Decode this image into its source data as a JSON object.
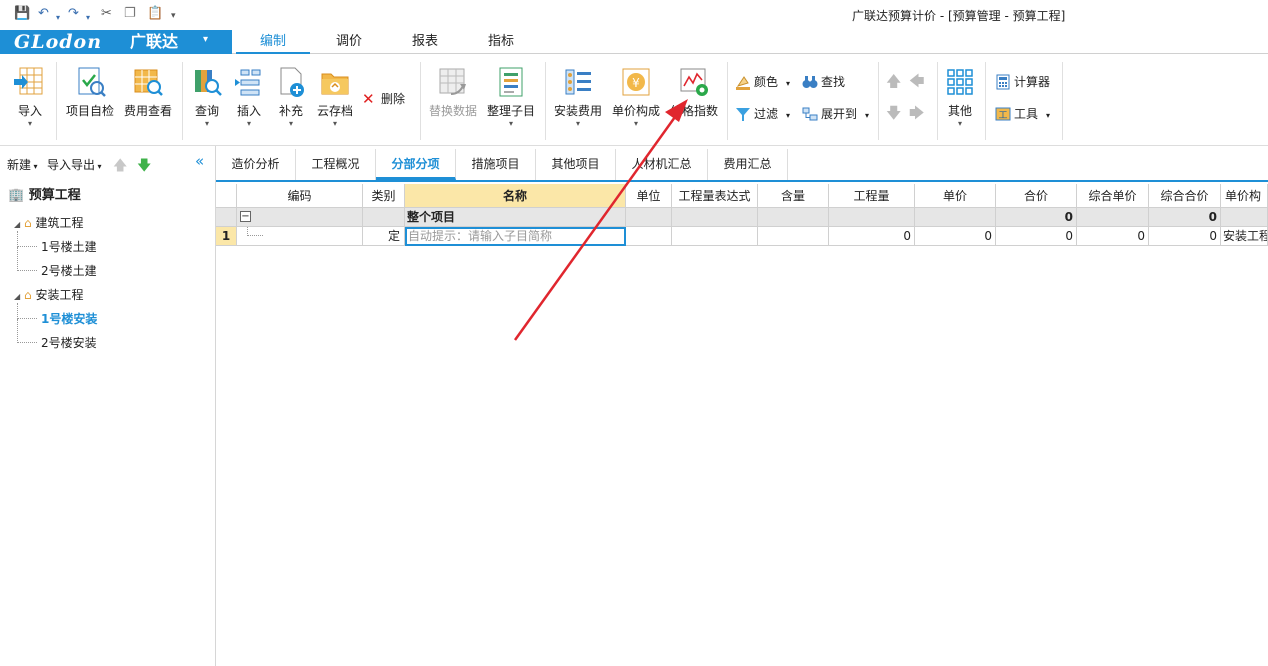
{
  "window": {
    "title": "广联达预算计价 - [预算管理 - 预算工程]"
  },
  "quick_access": [
    "save-icon",
    "undo-icon",
    "redo-icon",
    "cut-icon",
    "copy-icon",
    "paste-icon",
    "customize-icon"
  ],
  "brand": {
    "text": "GLodon",
    "cn": "广联达",
    "dropdown": "▾"
  },
  "menu_tabs": [
    "编制",
    "调价",
    "报表",
    "指标"
  ],
  "ribbon": {
    "import": "导入",
    "self_check": "项目自检",
    "fee_view": "费用查看",
    "query": "查询",
    "insert": "插入",
    "supplement": "补充",
    "cloud": "云存档",
    "delete": "删除",
    "replace_data": "替换数据",
    "organize": "整理子目",
    "install_fee": "安装费用",
    "unit_price": "单价构成",
    "price_index": "价格指数",
    "color": "颜色",
    "find": "查找",
    "filter": "过滤",
    "expand": "展开到",
    "other": "其他",
    "calculator": "计算器",
    "tools": "工具"
  },
  "left_panel": {
    "new": "新建",
    "import_export": "导入导出",
    "tree": {
      "root": "预算工程",
      "groups": [
        {
          "name": "建筑工程",
          "items": [
            "1号楼土建",
            "2号楼土建"
          ]
        },
        {
          "name": "安装工程",
          "items": [
            "1号楼安装",
            "2号楼安装"
          ]
        }
      ],
      "selected": "1号楼安装"
    }
  },
  "content_tabs": [
    "造价分析",
    "工程概况",
    "分部分项",
    "措施项目",
    "其他项目",
    "人材机汇总",
    "费用汇总"
  ],
  "active_tab": "分部分项",
  "grid": {
    "headers": [
      "编码",
      "类别",
      "名称",
      "单位",
      "工程量表达式",
      "含量",
      "工程量",
      "单价",
      "合价",
      "综合单价",
      "综合合价",
      "单价构"
    ],
    "summary_row": {
      "toggle": "−",
      "name": "整个项目",
      "total": "0",
      "total2": "0"
    },
    "rows": [
      {
        "index": "1",
        "type": "定",
        "name_placeholder": "自动提示：请输入子目简称",
        "quantity": "0",
        "unit_price": "0",
        "total": "0",
        "comp_price": "0",
        "comp_total": "0",
        "unit_comp": "安装工程"
      }
    ]
  },
  "colors": {
    "accent": "#1e8fd6",
    "arrow": "#e0262e"
  }
}
